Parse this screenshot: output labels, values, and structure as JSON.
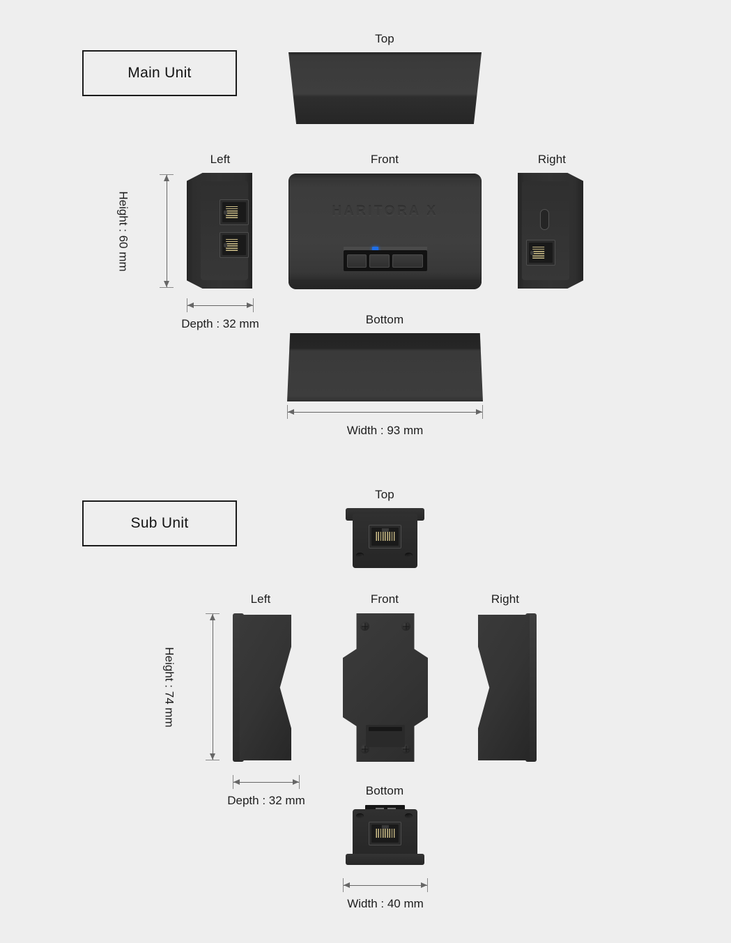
{
  "page": {
    "background_color": "#eeeeee",
    "text_color": "#1b1b1b"
  },
  "units": [
    {
      "id": "main-unit",
      "label": "Main Unit",
      "brand_logo": "HARITORA X",
      "views": {
        "top": "Top",
        "left": "Left",
        "front": "Front",
        "right": "Right",
        "bottom": "Bottom"
      },
      "dimensions": {
        "height": "Height : 60 mm",
        "depth": "Depth : 32 mm",
        "width": "Width : 93 mm"
      },
      "ports": {
        "left_view": [
          "rj45-jack",
          "rj45-jack"
        ],
        "right_view": [
          "usb-c-port",
          "rj45-jack"
        ]
      },
      "front_controls": {
        "buttons": 3,
        "leds": 3,
        "active_led_index": 0,
        "active_led_color": "#1f6fe8",
        "idle_led_color": "#4a4a4a"
      }
    },
    {
      "id": "sub-unit",
      "label": "Sub Unit",
      "views": {
        "top": "Top",
        "left": "Left",
        "front": "Front",
        "right": "Right",
        "bottom": "Bottom"
      },
      "dimensions": {
        "height": "Height : 74 mm",
        "depth": "Depth : 32 mm",
        "width": "Width : 40 mm"
      },
      "ports": {
        "top_view": [
          "rj45-jack"
        ],
        "bottom_view": [
          "rj45-jack"
        ]
      },
      "front_screws": 4
    }
  ]
}
